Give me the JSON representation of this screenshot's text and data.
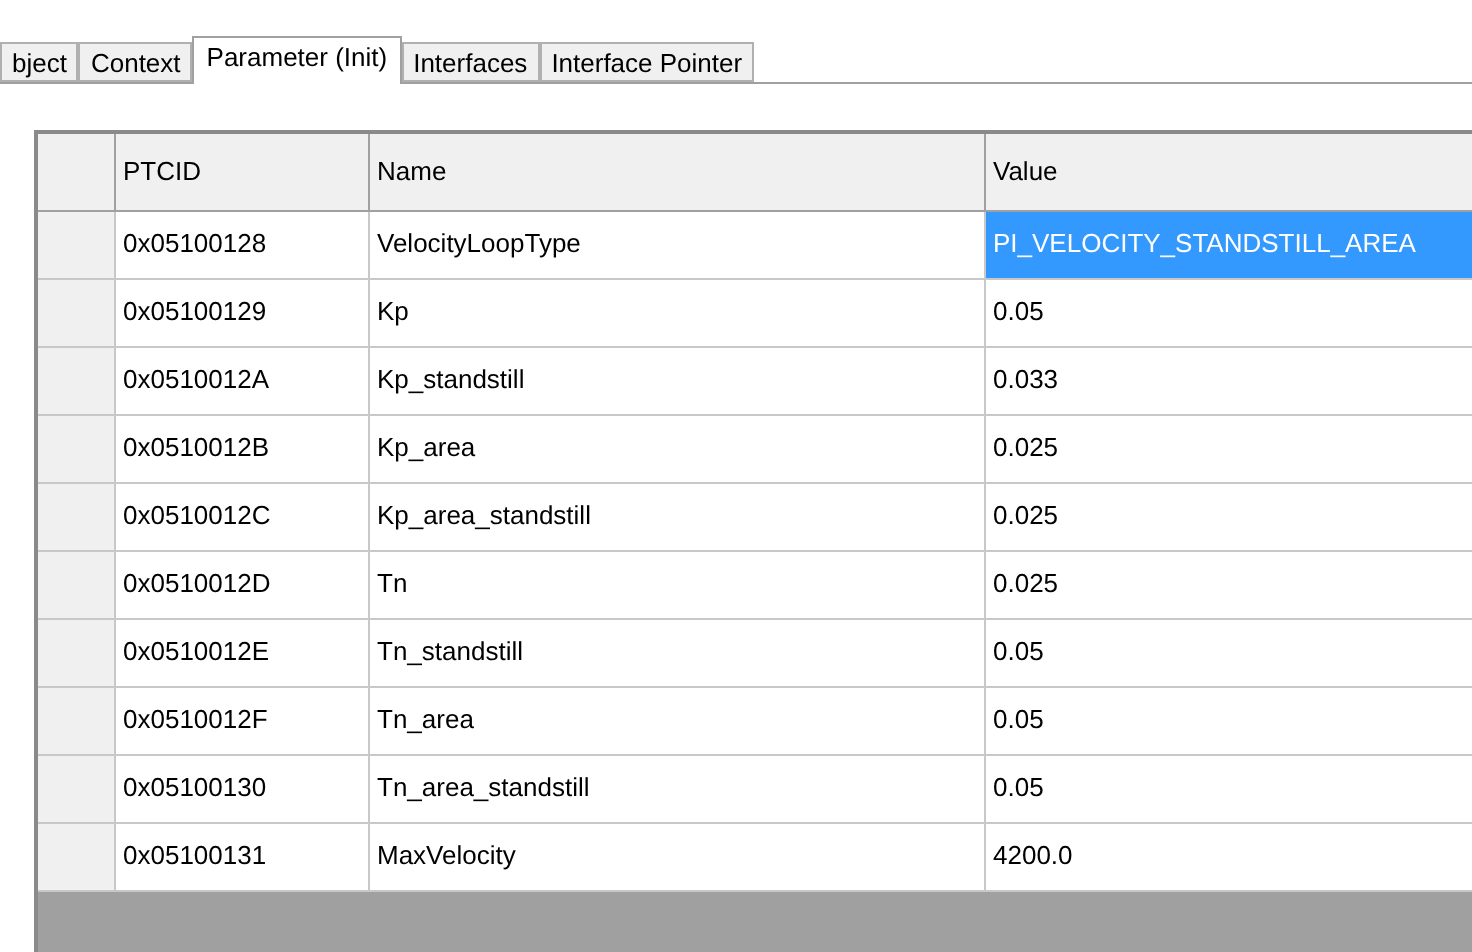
{
  "tabs": [
    {
      "label": "bject",
      "selected": false
    },
    {
      "label": "Context",
      "selected": false
    },
    {
      "label": "Parameter (Init)",
      "selected": true
    },
    {
      "label": "Interfaces",
      "selected": false
    },
    {
      "label": "Interface Pointer",
      "selected": false
    }
  ],
  "table": {
    "columns": [
      "PTCID",
      "Name",
      "Value"
    ],
    "rows": [
      {
        "cells": [
          "0x05100128",
          "VelocityLoopType",
          "PI_VELOCITY_STANDSTILL_AREA"
        ],
        "selected": true
      },
      {
        "cells": [
          "0x05100129",
          "Kp",
          "0.05"
        ],
        "selected": false
      },
      {
        "cells": [
          "0x0510012A",
          "Kp_standstill",
          "0.033"
        ],
        "selected": false
      },
      {
        "cells": [
          "0x0510012B",
          "Kp_area",
          "0.025"
        ],
        "selected": false
      },
      {
        "cells": [
          "0x0510012C",
          "Kp_area_standstill",
          "0.025"
        ],
        "selected": false
      },
      {
        "cells": [
          "0x0510012D",
          "Tn",
          "0.025"
        ],
        "selected": false
      },
      {
        "cells": [
          "0x0510012E",
          "Tn_standstill",
          "0.05"
        ],
        "selected": false
      },
      {
        "cells": [
          "0x0510012F",
          "Tn_area",
          "0.05"
        ],
        "selected": false
      },
      {
        "cells": [
          "0x05100130",
          "Tn_area_standstill",
          "0.05"
        ],
        "selected": false
      },
      {
        "cells": [
          "0x05100131",
          "MaxVelocity",
          "4200.0"
        ],
        "selected": false
      }
    ]
  }
}
